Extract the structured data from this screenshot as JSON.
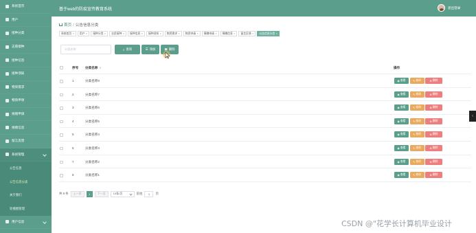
{
  "header": {
    "app_title": "基于web的防疫宣传教育系统",
    "logout_label": "退出登录"
  },
  "sidebar": {
    "items": [
      {
        "label": "系统首页",
        "icon": "home-icon"
      },
      {
        "label": "用户",
        "icon": "user-icon"
      },
      {
        "label": "接种分类",
        "icon": "grid-icon"
      },
      {
        "label": "志愿接种",
        "icon": "grid-icon"
      },
      {
        "label": "接种信息",
        "icon": "grid-icon"
      },
      {
        "label": "接种须知",
        "icon": "grid-icon"
      },
      {
        "label": "物资需求",
        "icon": "grid-icon"
      },
      {
        "label": "物资申领",
        "icon": "grid-icon"
      },
      {
        "label": "捐赠申请",
        "icon": "grid-icon"
      },
      {
        "label": "捐赠信息",
        "icon": "grid-icon"
      },
      {
        "label": "留言反馈",
        "icon": "grid-icon"
      },
      {
        "label": "系统管理",
        "icon": "gear-icon"
      }
    ],
    "sub_items": [
      {
        "label": "公告信息"
      },
      {
        "label": "公告信息分类"
      },
      {
        "label": "关于我们"
      },
      {
        "label": "轮播图管理"
      }
    ],
    "last_item": {
      "label": "用户信息",
      "icon": "user-icon"
    }
  },
  "breadcrumb": {
    "home": "首页",
    "current": "公告信息分类"
  },
  "tabs": [
    {
      "label": "系统首页"
    },
    {
      "label": "用户"
    },
    {
      "label": "接种分类"
    },
    {
      "label": "志愿接种"
    },
    {
      "label": "接种信息"
    },
    {
      "label": "接种须知"
    },
    {
      "label": "物资需求"
    },
    {
      "label": "物资申请"
    },
    {
      "label": "捐赠申请"
    },
    {
      "label": "捐赠信息"
    },
    {
      "label": "留言反馈"
    },
    {
      "label": "公告信息分类"
    }
  ],
  "toolbar": {
    "search_placeholder": "分类名称",
    "search_label": "查询",
    "add_label": "添加",
    "delete_label": "删除"
  },
  "table": {
    "headers": {
      "index": "序号",
      "name": "分类名称",
      "ops": "操作"
    },
    "rows": [
      {
        "index": "1",
        "name": "分类名称8"
      },
      {
        "index": "2",
        "name": "分类名称7"
      },
      {
        "index": "3",
        "name": "分类名称6"
      },
      {
        "index": "4",
        "name": "分类名称5"
      },
      {
        "index": "5",
        "name": "分类名称4"
      },
      {
        "index": "6",
        "name": "分类名称3"
      },
      {
        "index": "7",
        "name": "分类名称2"
      },
      {
        "index": "8",
        "name": "分类名称1"
      }
    ],
    "op_labels": {
      "view": "查看",
      "edit": "修改",
      "delete": "删除"
    }
  },
  "pager": {
    "total": "共 8 条",
    "prev": "上一页",
    "page": "1",
    "next": "下一页",
    "page_size": "10条/页",
    "goto": "前往",
    "goto_value": "1",
    "page_unit": "页"
  },
  "side_toggle": "‹",
  "watermark": "CSDN @\"花学长计算机毕业设计",
  "colors": {
    "primary": "#5b9e8c",
    "edit": "#e9a95e",
    "delete": "#ee7e7e"
  }
}
